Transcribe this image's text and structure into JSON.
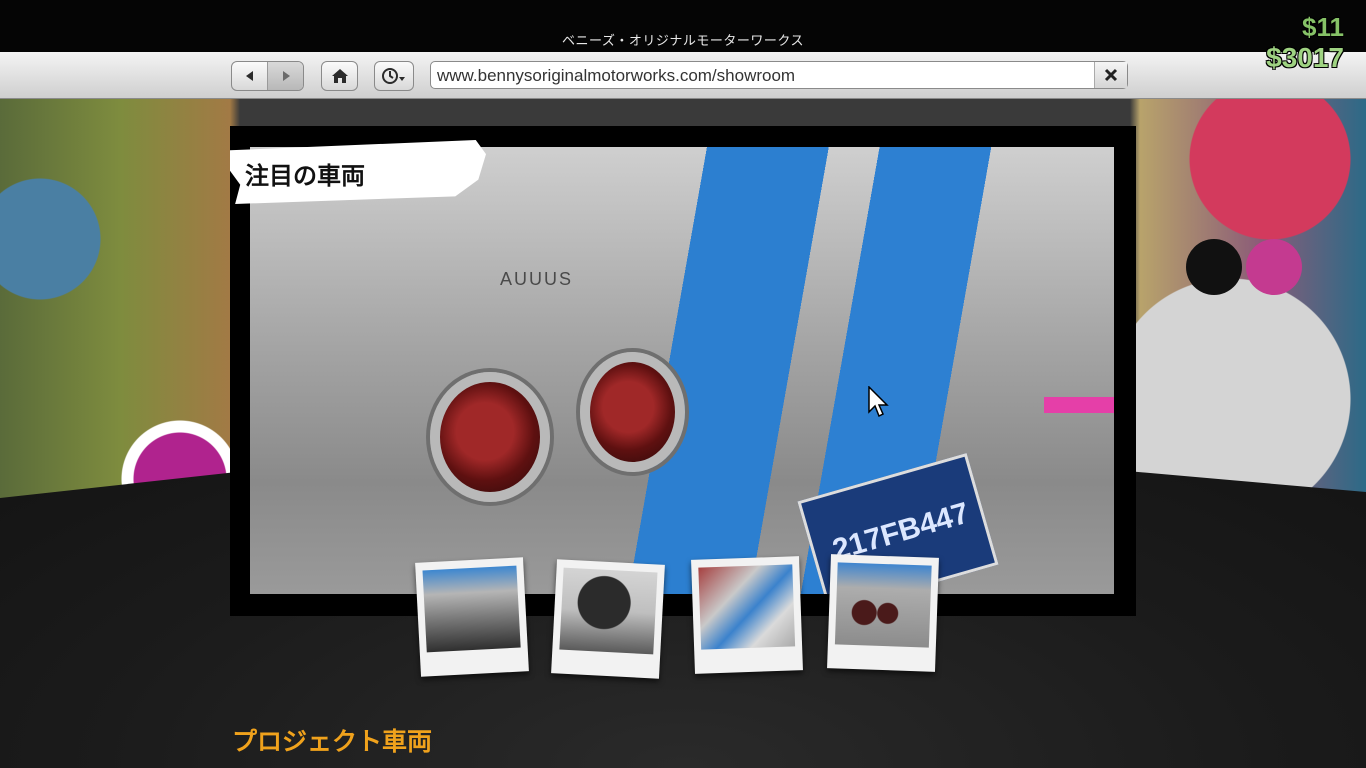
{
  "window": {
    "title": "ベニーズ・オリジナルモーターワークス"
  },
  "hud": {
    "cash": "$11",
    "bank": "$3017",
    "cash_color": "#86c267",
    "bank_color": "#9fd382"
  },
  "browser": {
    "url": "www.bennysoriginalmotorworks.com/showroom",
    "back_icon": "back-arrow-icon",
    "forward_icon": "forward-arrow-icon",
    "home_icon": "home-icon",
    "history_icon": "clock-dropdown-icon",
    "close_icon": "close-icon"
  },
  "featured": {
    "label": "注目の車両",
    "plate_text": "217FB447",
    "emblem_text": "AUUUS"
  },
  "thumbnails": [
    {
      "name": "front-view"
    },
    {
      "name": "interior-view"
    },
    {
      "name": "hood-view"
    },
    {
      "name": "rear-view"
    }
  ],
  "sections": {
    "project_vehicles": "プロジェクト車両"
  },
  "colors": {
    "accent_orange": "#f0a21c",
    "stripe_blue": "#2c7fd0"
  }
}
